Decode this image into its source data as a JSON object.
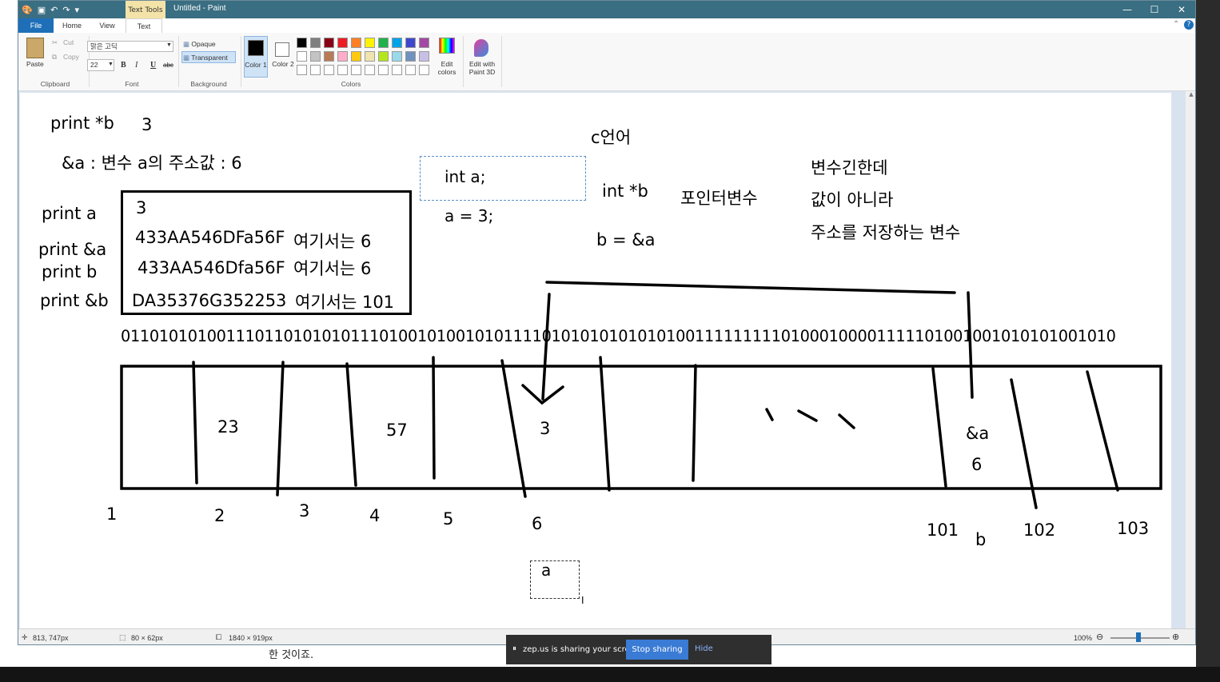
{
  "window": {
    "title": "Untitled - Paint",
    "context_tab": "Text Tools",
    "controls": {
      "minimize": "—",
      "maximize": "☐",
      "close": "✕"
    }
  },
  "tabs": [
    "File",
    "Home",
    "View",
    "Text"
  ],
  "ribbon": {
    "clipboard": {
      "paste": "Paste",
      "cut": "Cut",
      "copy": "Copy",
      "label": "Clipboard"
    },
    "font": {
      "family": "맑은 고딕",
      "size": "22",
      "bold": "B",
      "italic": "I",
      "underline": "U",
      "strike": "abc",
      "label": "Font"
    },
    "background": {
      "opaque": "Opaque",
      "transparent": "Transparent",
      "label": "Background"
    },
    "colors": {
      "color1": "Color 1",
      "color2": "Color 2",
      "edit": "Edit colors",
      "label": "Colors",
      "palette_row1": [
        "#000000",
        "#7f7f7f",
        "#880015",
        "#ed1c24",
        "#ff7f27",
        "#fff200",
        "#22b14c",
        "#00a2e8",
        "#3f48cc",
        "#a349a4"
      ],
      "palette_row2": [
        "#ffffff",
        "#c3c3c3",
        "#b97a57",
        "#ffaec9",
        "#ffc90e",
        "#efe4b0",
        "#b5e61d",
        "#99d9ea",
        "#7092be",
        "#c8bfe7"
      ]
    },
    "paint3d": "Edit with Paint 3D"
  },
  "canvas": {
    "print_b_star": "print *b",
    "print_b_star_val": "3",
    "addr_note": "&a : 변수 a의 주소값 : 6",
    "print_a": "print a",
    "print_amp_a": "print &a",
    "print_b": "print b",
    "print_amp_b": "print &b",
    "box_r1": "3",
    "box_r2": "433AA546DFa56F",
    "box_r2_note": "여기서는 6",
    "box_r3": "433AA546Dfa56F",
    "box_r3_note": "여기서는 6",
    "box_r4": "DA35376G352253",
    "box_r4_note": "여기서는 101",
    "c_lang": "c언어",
    "int_a": "int a;",
    "a_eq_3": "a = 3;",
    "int_ptr_b": "int *b",
    "pointer_var": "포인터변수",
    "b_eq_amp_a": "b = &a",
    "desc1": "변수긴한데",
    "desc2": "값이 아니라",
    "desc3": "주소를 저장하는 변수",
    "bits": "01101010100111011010101011101001010010101111010101010101010011111111101000100001111101001001010101001010",
    "cell_23": "23",
    "cell_57": "57",
    "cell_3": "3",
    "cell_amp_a": "&a",
    "cell_6": "6",
    "addr_1": "1",
    "addr_2": "2",
    "addr_3": "3",
    "addr_4": "4",
    "addr_5": "5",
    "addr_6": "6",
    "addr_101": "101",
    "addr_b": "b",
    "addr_102": "102",
    "addr_103": "103",
    "label_a": "a"
  },
  "status": {
    "cursor": "813, 747px",
    "selection": "80 × 62px",
    "size": "1840 × 919px",
    "zoom": "100%"
  },
  "sharing": {
    "message": "zep.us is sharing your screen.",
    "stop": "Stop sharing",
    "hide": "Hide"
  },
  "below_text": "한 것이죠."
}
